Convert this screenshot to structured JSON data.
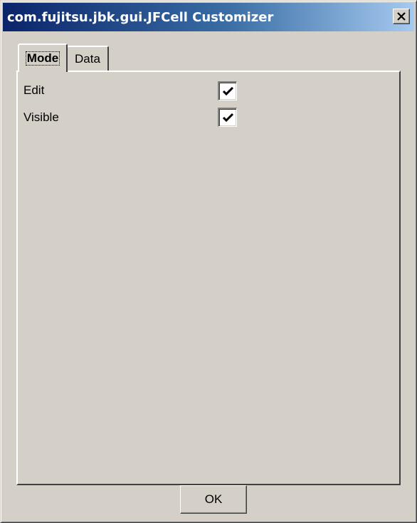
{
  "window": {
    "title": "com.fujitsu.jbk.gui.JFCell Customizer"
  },
  "tabs": [
    {
      "label": "Mode",
      "selected": true
    },
    {
      "label": "Data",
      "selected": false
    }
  ],
  "mode_panel": {
    "rows": [
      {
        "label": "Edit",
        "checked": true
      },
      {
        "label": "Visible",
        "checked": true
      }
    ]
  },
  "buttons": {
    "ok_label": "OK"
  },
  "icons": {
    "close": "close-icon",
    "check": "checkmark-icon"
  },
  "colors": {
    "title_gradient_start": "#0a246a",
    "title_gradient_end": "#a6caf0",
    "face": "#d4d0c8"
  }
}
